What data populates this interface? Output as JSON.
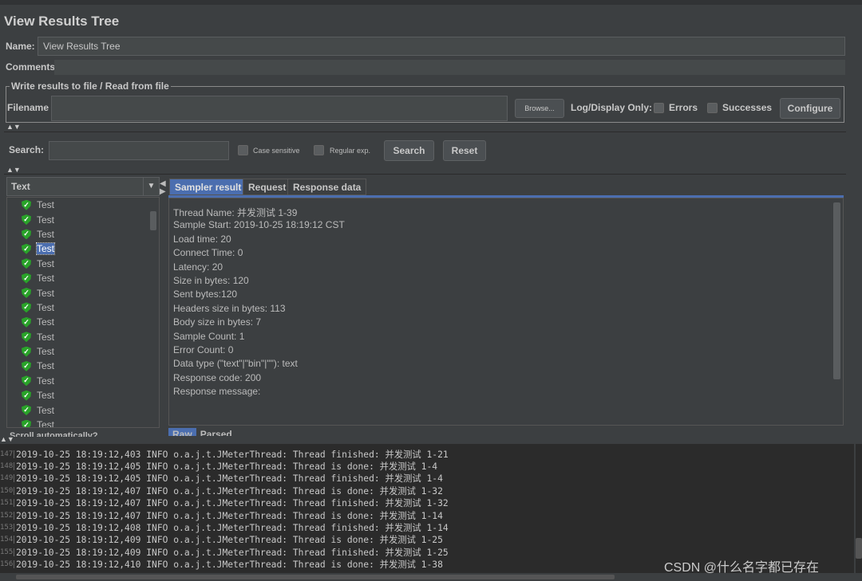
{
  "title": "View Results Tree",
  "name_label": "Name:",
  "name_value": "View Results Tree",
  "comments_label": "Comments:",
  "file_group": "Write results to file / Read from file",
  "filename_label": "Filename",
  "browse": "Browse...",
  "log_display": "Log/Display Only:",
  "errors": "Errors",
  "successes": "Successes",
  "configure": "Configure",
  "search_label": "Search:",
  "case_sensitive": "Case sensitive",
  "regular_exp": "Regular exp.",
  "search_btn": "Search",
  "reset_btn": "Reset",
  "renderer": "Text",
  "tree_items": [
    "Test",
    "Test",
    "Test",
    "Test",
    "Test",
    "Test",
    "Test",
    "Test",
    "Test",
    "Test",
    "Test",
    "Test",
    "Test",
    "Test",
    "Test",
    "Test"
  ],
  "selected_index": 3,
  "scroll_auto": "Scroll automatically?",
  "tabs": [
    "Sampler result",
    "Request",
    "Response data"
  ],
  "bottom_tabs": [
    "Raw",
    "Parsed"
  ],
  "result_lines": [
    "Thread Name: 并发测试 1-39",
    "Sample Start: 2019-10-25 18:19:12 CST",
    "Load time: 20",
    "Connect Time: 0",
    "Latency: 20",
    "Size in bytes: 120",
    "Sent bytes:120",
    "Headers size in bytes: 113",
    "Body size in bytes: 7",
    "Sample Count: 1",
    "Error Count: 0",
    "Data type (\"text\"|\"bin\"|\"\"): text",
    "Response code: 200",
    "Response message:"
  ],
  "log_lines": [
    {
      "n": "147",
      "t": "2019-10-25 18:19:12,403 INFO o.a.j.t.JMeterThread: Thread finished: 并发测试 1-21"
    },
    {
      "n": "148",
      "t": "2019-10-25 18:19:12,405 INFO o.a.j.t.JMeterThread: Thread is done: 并发测试 1-4"
    },
    {
      "n": "149",
      "t": "2019-10-25 18:19:12,405 INFO o.a.j.t.JMeterThread: Thread finished: 并发测试 1-4"
    },
    {
      "n": "150",
      "t": "2019-10-25 18:19:12,407 INFO o.a.j.t.JMeterThread: Thread is done: 并发测试 1-32"
    },
    {
      "n": "151",
      "t": "2019-10-25 18:19:12,407 INFO o.a.j.t.JMeterThread: Thread finished: 并发测试 1-32"
    },
    {
      "n": "152",
      "t": "2019-10-25 18:19:12,407 INFO o.a.j.t.JMeterThread: Thread is done: 并发测试 1-14"
    },
    {
      "n": "153",
      "t": "2019-10-25 18:19:12,408 INFO o.a.j.t.JMeterThread: Thread finished: 并发测试 1-14"
    },
    {
      "n": "154",
      "t": "2019-10-25 18:19:12,409 INFO o.a.j.t.JMeterThread: Thread is done: 并发测试 1-25"
    },
    {
      "n": "155",
      "t": "2019-10-25 18:19:12,409 INFO o.a.j.t.JMeterThread: Thread finished: 并发测试 1-25"
    },
    {
      "n": "156",
      "t": "2019-10-25 18:19:12,410 INFO o.a.j.t.JMeterThread: Thread is done: 并发测试 1-38"
    }
  ],
  "watermark": "CSDN @什么名字都已存在",
  "colors": {
    "bg": "#3c3f41",
    "log_bg": "#2b2b2b",
    "selection": "#4b6eaf",
    "success": "#29a329"
  }
}
